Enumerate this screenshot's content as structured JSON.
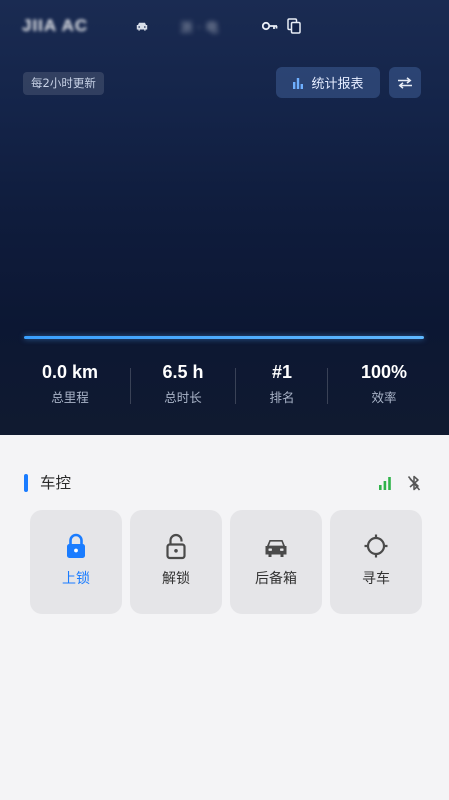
{
  "header": {
    "car_name": "JIIA AC",
    "plate_number": "浙 ·  电",
    "icons": [
      "car-icon",
      "key-icon",
      "copy-icon"
    ]
  },
  "overview": {
    "update_note": "每2小时更新",
    "report_button": "统计报表",
    "switch_icon": "swap-icon"
  },
  "stats": [
    {
      "value": "0.0 km",
      "label": "总里程"
    },
    {
      "value": "6.5 h",
      "label": "总时长"
    },
    {
      "value": "#1",
      "label": "排名"
    },
    {
      "value": "100%",
      "label": "效率"
    }
  ],
  "control": {
    "title": "车控",
    "signal_icon": "signal-icon",
    "bluetooth_icon": "bluetooth-off-icon",
    "buttons": [
      {
        "label": "上锁",
        "icon": "lock-icon",
        "active": true
      },
      {
        "label": "解锁",
        "icon": "unlock-icon",
        "active": false
      },
      {
        "label": "后备箱",
        "icon": "car-front-icon",
        "active": false
      },
      {
        "label": "寻车",
        "icon": "locate-icon",
        "active": false
      }
    ]
  },
  "colors": {
    "accent": "#1a7cff",
    "signal": "#2fb34a",
    "hero_top": "#1a2b52",
    "hero_bottom": "#101a30",
    "tile_bg": "#e5e5e8"
  }
}
